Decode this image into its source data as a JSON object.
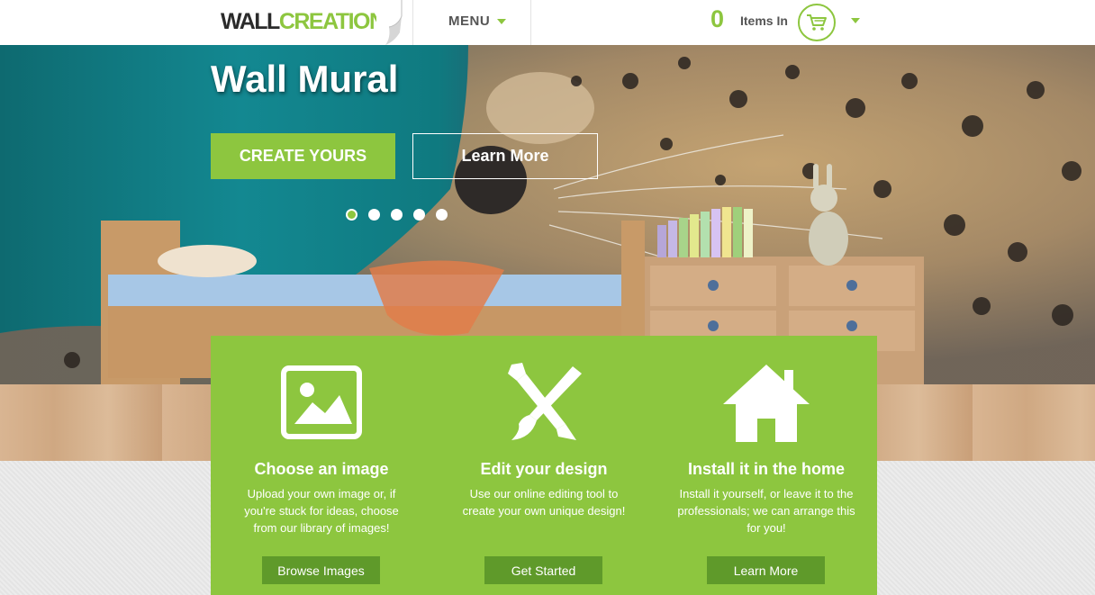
{
  "header": {
    "logo_part1": "WALL",
    "logo_part2": "CREATIONS",
    "menu_label": "MENU",
    "cart_count": "0",
    "cart_label": "Items In"
  },
  "hero": {
    "title": "Wall Mural",
    "create_button": "CREATE YOURS",
    "learn_button": "Learn More",
    "slide_count": 5,
    "active_slide": 1
  },
  "features": [
    {
      "icon": "image-icon",
      "title": "Choose an image",
      "description": "Upload your own image or, if you're stuck for ideas, choose from our library of images!",
      "button": "Browse Images"
    },
    {
      "icon": "brush-pen-icon",
      "title": "Edit your design",
      "description": "Use our online editing tool to create your own unique design!",
      "button": "Get Started"
    },
    {
      "icon": "house-icon",
      "title": "Install it in the home",
      "description": "Install it yourself, or leave it to the professionals; we can arrange this for you!",
      "button": "Learn More"
    }
  ],
  "colors": {
    "accent": "#8dc63f",
    "accent_dark": "#5f9a2a",
    "text_dark": "#555555"
  }
}
